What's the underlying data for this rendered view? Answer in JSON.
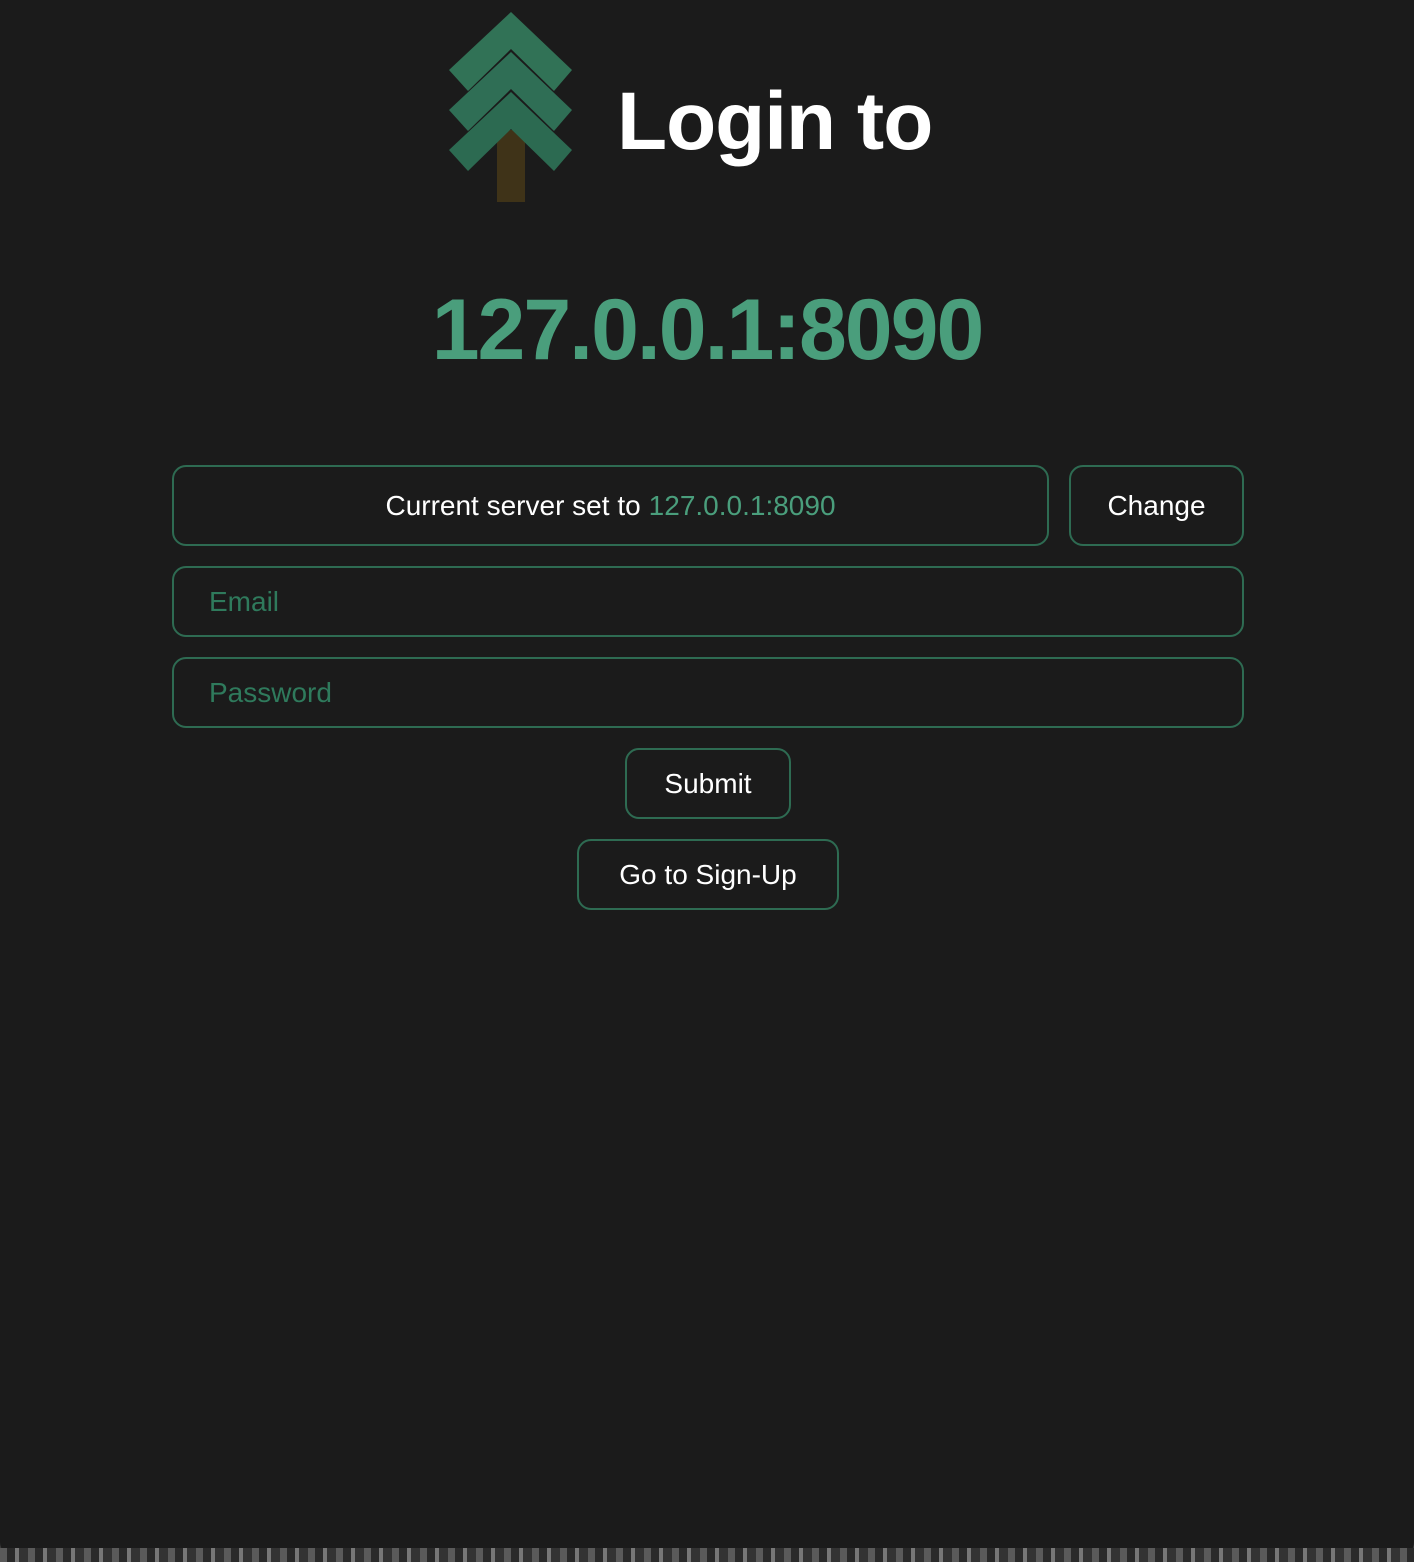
{
  "header": {
    "logo_icon": "pine-tree-icon",
    "title": "Login to"
  },
  "server": {
    "address_display": "127.0.0.1:8090",
    "current_prefix": "Current server set to",
    "current_value": "127.0.0.1:8090",
    "change_label": "Change"
  },
  "form": {
    "email_placeholder": "Email",
    "email_value": "",
    "password_placeholder": "Password",
    "password_value": "",
    "submit_label": "Submit",
    "signup_label": "Go to Sign-Up"
  },
  "colors": {
    "background": "#1b1b1b",
    "accent": "#4a9e7c",
    "border": "#2e6b52",
    "tree_green": "#2f6e55",
    "trunk_brown": "#3f3318",
    "text": "#ffffff"
  }
}
